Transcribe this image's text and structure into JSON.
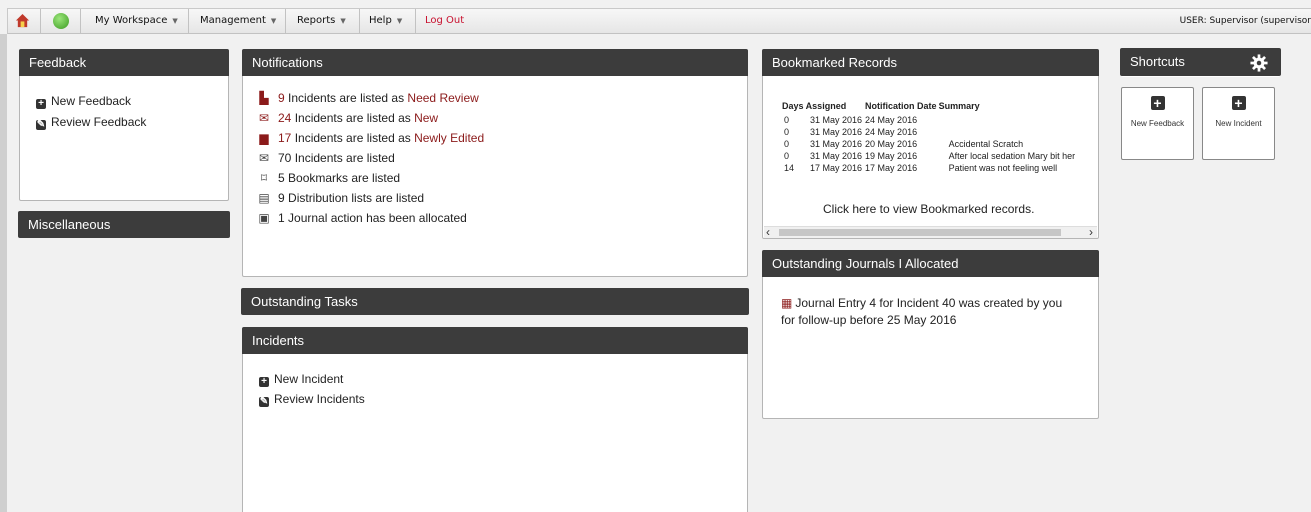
{
  "toolbar": {
    "home_icon": "home-icon",
    "refresh_icon": "refresh-icon",
    "menus": [
      "My Workspace",
      "Management",
      "Reports",
      "Help"
    ],
    "logout": "Log Out",
    "user": "USER: Supervisor (supervisor"
  },
  "feedback": {
    "title": "Feedback",
    "links": [
      "New Feedback",
      "Review Feedback"
    ]
  },
  "misc": {
    "title": "Miscellaneous"
  },
  "notifications": {
    "title": "Notifications",
    "rows": [
      {
        "count": "9",
        "text": " Incidents are listed as ",
        "status": "Need Review",
        "icon": "review-icon"
      },
      {
        "count": "24",
        "text": " Incidents are listed as ",
        "status": "New",
        "icon": "envelope-icon"
      },
      {
        "count": "17",
        "text": " Incidents are listed as ",
        "status": "Newly Edited",
        "icon": "document-icon"
      },
      {
        "count": "70",
        "text": " Incidents are listed",
        "status": "",
        "icon": "envelope-outline-icon"
      },
      {
        "count": "5",
        "text": " Bookmarks are listed",
        "status": "",
        "icon": "bookmark-icon"
      },
      {
        "count": "9",
        "text": " Distribution lists are listed",
        "status": "",
        "icon": "list-icon"
      },
      {
        "count": "1",
        "text": " Journal action has been allocated",
        "status": "",
        "icon": "journal-icon"
      }
    ]
  },
  "tasks": {
    "title": "Outstanding Tasks"
  },
  "incidents": {
    "title": "Incidents",
    "links": [
      "New Incident",
      "Review Incidents"
    ]
  },
  "bookmarks": {
    "title": "Bookmarked Records",
    "headers": [
      "Days Assigned",
      "Notification Date",
      "Summary"
    ],
    "rows": [
      {
        "days": "0",
        "assigned": "31 May 2016",
        "notified": "24 May 2016",
        "summary": ""
      },
      {
        "days": "0",
        "assigned": "31 May 2016",
        "notified": "24 May 2016",
        "summary": ""
      },
      {
        "days": "0",
        "assigned": "31 May 2016",
        "notified": "20 May 2016",
        "summary": "Accidental Scratch"
      },
      {
        "days": "0",
        "assigned": "31 May 2016",
        "notified": "19 May 2016",
        "summary": "After local sedation Mary bit her"
      },
      {
        "days": "14",
        "assigned": "17 May 2016",
        "notified": "17 May 2016",
        "summary": "Patient was not feeling well"
      }
    ],
    "footer_link": "Click here to view Bookmarked records."
  },
  "journals": {
    "title": "Outstanding Journals I Allocated",
    "entry_line1": "Journal Entry 4 for Incident 40 was created by you",
    "entry_line2": "for follow-up before 25 May 2016"
  },
  "shortcuts": {
    "title": "Shortcuts",
    "buttons": [
      "New Feedback",
      "New Incident"
    ]
  },
  "colors": {
    "header": "#3c3c3c",
    "accent_red": "#8b1a1a",
    "logout_red": "#c8102e"
  }
}
